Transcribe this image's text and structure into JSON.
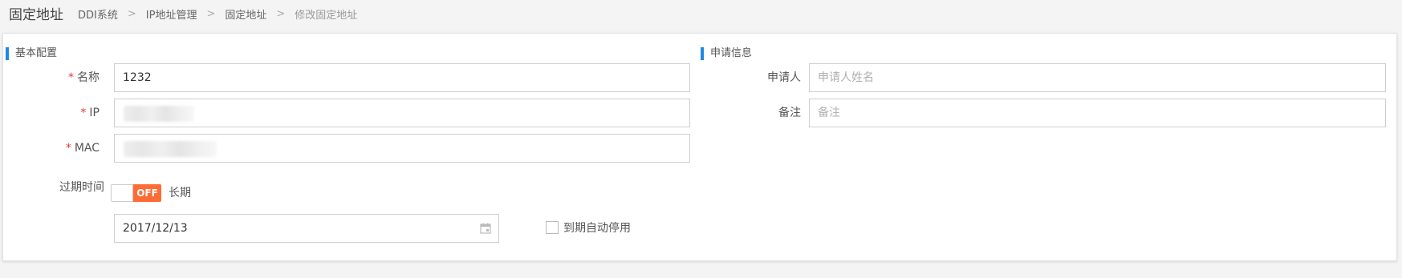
{
  "header": {
    "title": "固定地址",
    "breadcrumb": [
      "DDI系统",
      "IP地址管理",
      "固定地址",
      "修改固定地址"
    ],
    "separator": ">"
  },
  "basic": {
    "section_title": "基本配置",
    "name_label": "名称",
    "name_value": "1232",
    "ip_label": "IP",
    "mac_label": "MAC",
    "required_mark": "*",
    "expire_label": "过期时间",
    "expire_toggle_state": "OFF",
    "expire_toggle_desc": "长期",
    "date_value": "2017/12/13",
    "auto_disable_label": "到期自动停用"
  },
  "apply": {
    "section_title": "申请信息",
    "applicant_label": "申请人",
    "applicant_placeholder": "申请人姓名",
    "remark_label": "备注",
    "remark_placeholder": "备注"
  },
  "colors": {
    "accent": "#1e88e5",
    "toggle_off": "#ff6b35",
    "required": "#e53935"
  }
}
